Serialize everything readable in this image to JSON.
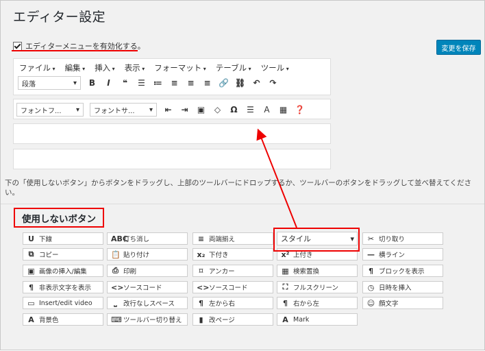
{
  "title": "エディター設定",
  "enable_label": "エディターメニューを有効化する。",
  "save_label": "変更を保存",
  "menubar": [
    "ファイル",
    "編集",
    "挿入",
    "表示",
    "フォーマット",
    "テーブル",
    "ツール"
  ],
  "toolbar1": {
    "format_select": "段落",
    "icons": [
      "bold-icon",
      "italic-icon",
      "blockquote-icon",
      "bullet-list-icon",
      "numbered-list-icon",
      "align-left-icon",
      "align-center-icon",
      "align-right-icon",
      "link-icon",
      "unlink-icon",
      "undo-icon",
      "redo-icon"
    ]
  },
  "toolbar2": {
    "font_family": "フォントフ...",
    "font_size": "フォントサ...",
    "icons": [
      "outdent-icon",
      "indent-icon",
      "paste-icon",
      "eraser-icon",
      "omega-icon",
      "hr-icon",
      "font-a-icon",
      "table-icon",
      "help-icon"
    ]
  },
  "hint_text": "下の「使用しないボタン」からボタンをドラッグし、上部のツールバーにドロップするか、ツールバーのボタンをドラッグして並べ替えてください。",
  "unused_heading": "使用しないボタン",
  "buttons": [
    [
      "下線",
      "打ち消し",
      "両端揃え",
      "スタイル",
      "切り取り"
    ],
    [
      "コピー",
      "貼り付け",
      "下付き",
      "上付き",
      "横ライン"
    ],
    [
      "画像の挿入/編集",
      "印刷",
      "アンカー",
      "検索置換",
      "ブロックを表示"
    ],
    [
      "非表示文字を表示",
      "ソースコード",
      "ソースコード",
      "フルスクリーン",
      "日時を挿入"
    ],
    [
      "Insert/edit video",
      "改行なしスペース",
      "左から右",
      "右から左",
      "顔文字"
    ],
    [
      "背景色",
      "ツールバー切り替え",
      "改ページ",
      "Mark"
    ]
  ],
  "button_icons": [
    [
      "U",
      "ABC",
      "≡",
      "",
      "✂"
    ],
    [
      "⧉",
      "📋",
      "x₂",
      "x²",
      "—"
    ],
    [
      "▣",
      "⎙",
      "⌑",
      "▦",
      "¶"
    ],
    [
      "¶",
      "<>",
      "<>",
      "⛶",
      "◷"
    ],
    [
      "▭",
      "⎵",
      "¶",
      "¶",
      "☺"
    ],
    [
      "A",
      "⌨",
      "▮",
      "A"
    ]
  ]
}
